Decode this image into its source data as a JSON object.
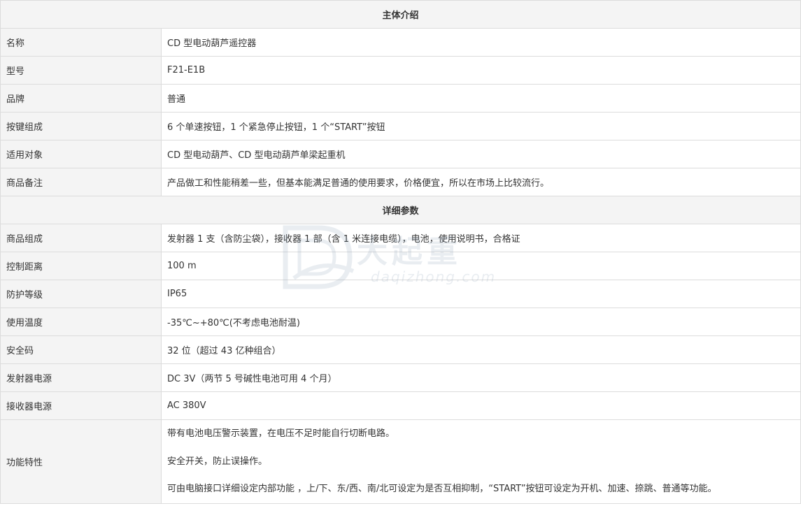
{
  "sections": {
    "intro_title": "主体介绍",
    "detail_title": "详细参数"
  },
  "intro_rows": [
    {
      "label": "名称",
      "value": "CD 型电动葫芦遥控器"
    },
    {
      "label": "型号",
      "value": "F21-E1B"
    },
    {
      "label": "品牌",
      "value": "普通"
    },
    {
      "label": "按键组成",
      "value": "6 个单速按钮，1 个紧急停止按钮，1 个“START”按钮"
    },
    {
      "label": "适用对象",
      "value": "CD 型电动葫芦、CD 型电动葫芦单梁起重机"
    },
    {
      "label": "商品备注",
      "value": "产品做工和性能稍差一些，但基本能满足普通的使用要求，价格便宜，所以在市场上比较流行。"
    }
  ],
  "detail_rows": [
    {
      "label": "商品组成",
      "value": "发射器 1 支（含防尘袋），接收器 1 部（含 1 米连接电缆），电池，使用说明书，合格证"
    },
    {
      "label": "控制距离",
      "value": "100 m"
    },
    {
      "label": "防护等级",
      "value": "IP65"
    },
    {
      "label": "使用温度",
      "value": "-35℃~+80℃(不考虑电池耐温)"
    },
    {
      "label": "安全码",
      "value": "32 位（超过 43 亿种组合）"
    },
    {
      "label": "发射器电源",
      "value": "DC 3V（两节 5 号碱性电池可用 4 个月）"
    },
    {
      "label": "接收器电源",
      "value": "AC 380V"
    }
  ],
  "features": {
    "label": "功能特性",
    "lines": [
      "带有电池电压警示装置，在电压不足时能自行切断电路。",
      "安全开关，防止误操作。",
      "可由电脑接口详细设定内部功能 ，上/下、东/西、南/北可设定为是否互相抑制，“START”按钮可设定为开机、加速、捺跳、普通等功能。"
    ]
  },
  "watermark": {
    "text_cn": "大起重",
    "text_en": "daqizhong.com"
  }
}
